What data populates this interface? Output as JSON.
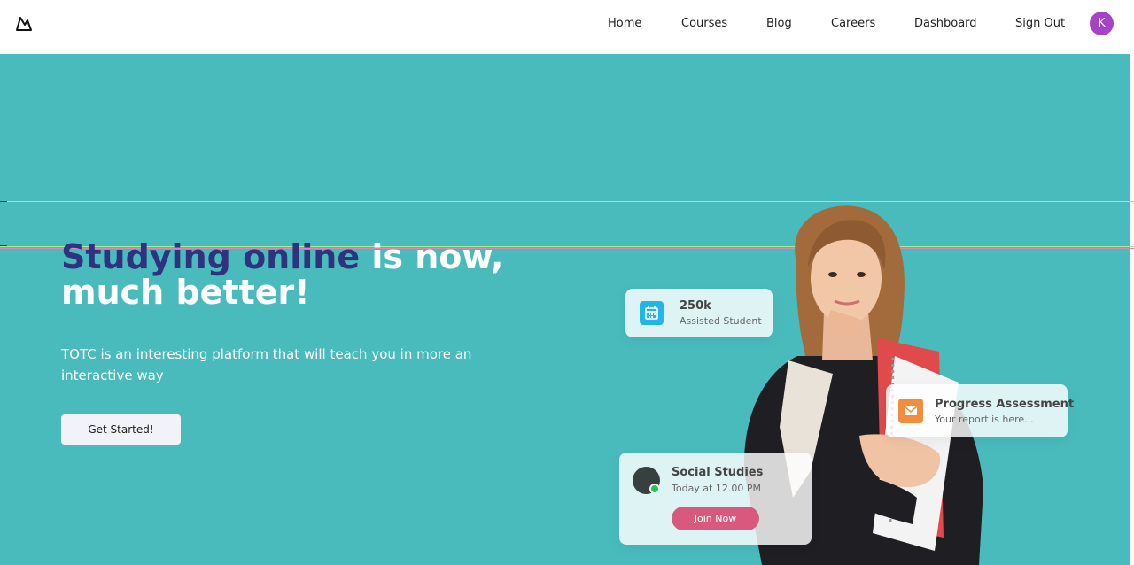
{
  "nav": {
    "logo_icon": "mountain-logo-icon",
    "links": [
      "Home",
      "Courses",
      "Blog",
      "Careers",
      "Dashboard",
      "Sign Out"
    ],
    "avatar_initial": "K"
  },
  "hero": {
    "title_accent": "Studying online",
    "title_rest_line1": " is now,",
    "title_line2": "much better!",
    "subtitle": "TOTC is an interesting platform that will teach you in more an interactive way",
    "cta_label": "Get Started!"
  },
  "cards": {
    "stat": {
      "icon": "calendar-icon",
      "value": "250k",
      "label": "Assisted Student"
    },
    "progress": {
      "icon": "mail-icon",
      "title": "Progress Assessment",
      "subtitle": "Your report is here..."
    },
    "class": {
      "title": "Social Studies",
      "time": "Today at 12.00 PM",
      "button_label": "Join Now"
    }
  },
  "colors": {
    "hero_bg": "#49BBBD",
    "title_accent": "#2F327D",
    "avatar_bg": "#A642C6",
    "join_button": "#D8587E",
    "stat_icon": "#22B6E6",
    "mail_icon": "#F48C3E",
    "online_dot": "#2BBF56"
  }
}
